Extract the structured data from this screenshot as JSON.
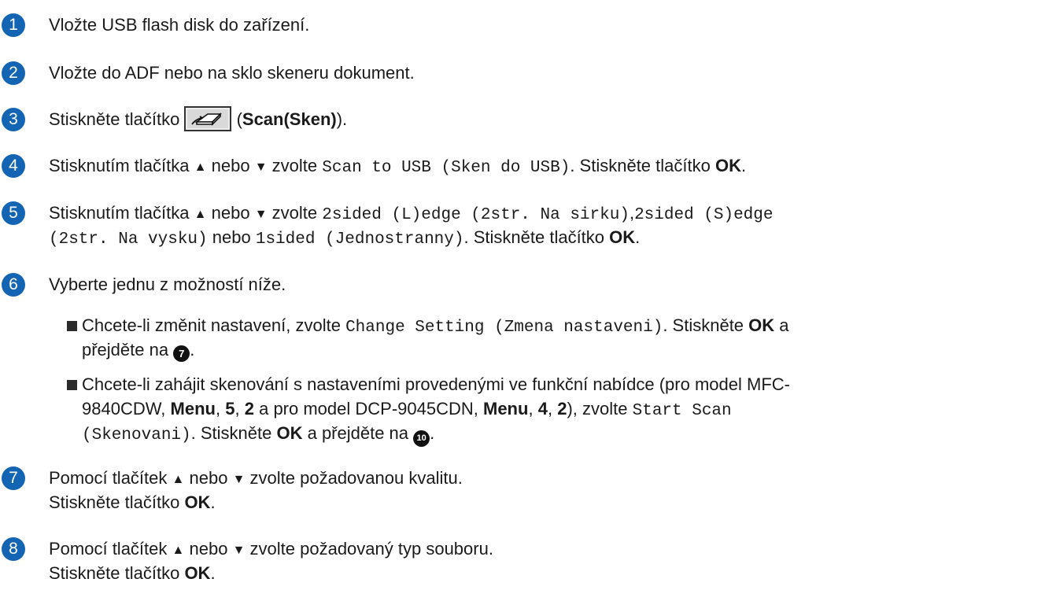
{
  "steps": [
    {
      "num": "1",
      "text": "Vložte USB flash disk do zařízení."
    },
    {
      "num": "2",
      "text": "Vložte do ADF nebo na sklo skeneru dokument."
    },
    {
      "num": "3",
      "pre": "Stiskněte tlačítko",
      "paren_open": "(",
      "bold": "Scan(Sken)",
      "paren_close": ")."
    },
    {
      "num": "4",
      "a": "Stisknutím tlačítka",
      "up": "▲",
      "nebo": "nebo",
      "down": "▼",
      "zvolte": "zvolte",
      "mono": "Scan to USB (Sken do USB)",
      "after": ". Stiskněte tlačítko",
      "ok": "OK",
      "end": "."
    },
    {
      "num": "5",
      "a": "Stisknutím tlačítka",
      "up": "▲",
      "nebo": "nebo",
      "down": "▼",
      "zvolte": "zvolte",
      "mono1": "2sided (L)edge (2str. Na sirku)",
      "comma": ",",
      "mono2": "2sided (S)edge",
      "mono3": "(2str. Na vysku)",
      "nebo2": "nebo",
      "mono4": "1sided (Jednostranny)",
      "after": ". Stiskněte tlačítko",
      "ok": "OK",
      "end": "."
    },
    {
      "num": "6",
      "text": "Vyberte jednu z možností níže."
    },
    {
      "num": "7",
      "line1_a": "Pomocí tlačítek",
      "up": "▲",
      "nebo": "nebo",
      "down": "▼",
      "line1_b": "zvolte požadovanou kvalitu.",
      "line2": "Stiskněte tlačítko",
      "ok": "OK",
      "end": "."
    },
    {
      "num": "8",
      "line1_a": "Pomocí tlačítek",
      "up": "▲",
      "nebo": "nebo",
      "down": "▼",
      "line1_b": "zvolte požadovaný typ souboru.",
      "line2": "Stiskněte tlačítko",
      "ok": "OK",
      "end": "."
    }
  ],
  "options": [
    {
      "a": "Chcete-li změnit nastavení, zvolte",
      "mono": "Change Setting (Zmena nastaveni)",
      "b": ". Stiskněte",
      "ok": "OK",
      "c": "a",
      "line2": "přejděte na",
      "ref": "7",
      "end": "."
    },
    {
      "a": "Chcete-li zahájit skenování s nastaveními provedenými ve funkční nabídce (pro model MFC-",
      "b1": "9840CDW,",
      "menu1": "Menu",
      "comma1": ",",
      "n1": "5",
      "comma2": ",",
      "n2": "2",
      "b2": "a pro model DCP-9045CDN,",
      "menu2": "Menu",
      "comma3": ",",
      "n3": "4",
      "comma4": ",",
      "n4": "2",
      "b3": "), zvolte",
      "mono1": "Start Scan",
      "mono2": "(Skenovani)",
      "c": ". Stiskněte",
      "ok": "OK",
      "d": "a přejděte na",
      "ref": "10",
      "end": "."
    }
  ],
  "icons": {
    "scan_button": "scan-key-icon",
    "accent": "#1464b4"
  }
}
